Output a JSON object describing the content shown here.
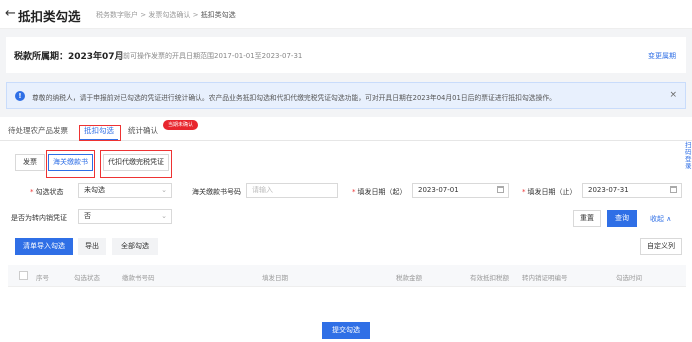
{
  "header": {
    "title": "抵扣类勾选",
    "breadcrumb": [
      "税务数字账户",
      ">",
      "发票勾选确认",
      ">"
    ],
    "breadcrumb_current": "抵扣类勾选"
  },
  "period": {
    "label": "税款所属期：2023年07月",
    "note": "当前可操作发票的开具日期范围2017-01-01至2023-07-31",
    "change_link": "变更属期"
  },
  "notice": {
    "icon": "info-icon",
    "text": "尊敬的纳税人，请于申报前对已勾选的凭证进行统计确认。农产品业务抵扣勾选和代扣代缴完税凭证勾选功能，可对开具日期在2023年04月01日后的票证进行抵扣勾选操作。",
    "close": "×"
  },
  "tabs": [
    {
      "label": "待处理农产品发票"
    },
    {
      "label": "抵扣勾选"
    },
    {
      "label": "统计确认"
    }
  ],
  "tab_badge": "当期未确认",
  "segments": [
    "发票",
    "海关缴款书",
    "代扣代缴完税凭证"
  ],
  "filters": {
    "status_label": "勾选状态",
    "status_value": "未勾选",
    "customs_no_label": "海关缴款书号码",
    "customs_no_placeholder": "请输入",
    "fill_start_label": "填发日期（起）",
    "fill_start_value": "2023-07-01",
    "fill_end_label": "填发日期（止）",
    "fill_end_value": "2023-07-31",
    "transfer_label": "是否为转内销凭证",
    "transfer_value": "否",
    "reset": "重置",
    "query": "查询",
    "collapse": "收起 ∧"
  },
  "toolbar": {
    "import": "清单导入勾选",
    "export": "导出",
    "select_all": "全部勾选",
    "custom_columns": "自定义列"
  },
  "table": {
    "columns": [
      "序号",
      "勾选状态",
      "缴款书号码",
      "填发日期",
      "税款金额",
      "有效抵扣税额",
      "转内销证明编号",
      "勾选时间"
    ]
  },
  "submit": "提交勾选",
  "side_tab": "扫码登录"
}
